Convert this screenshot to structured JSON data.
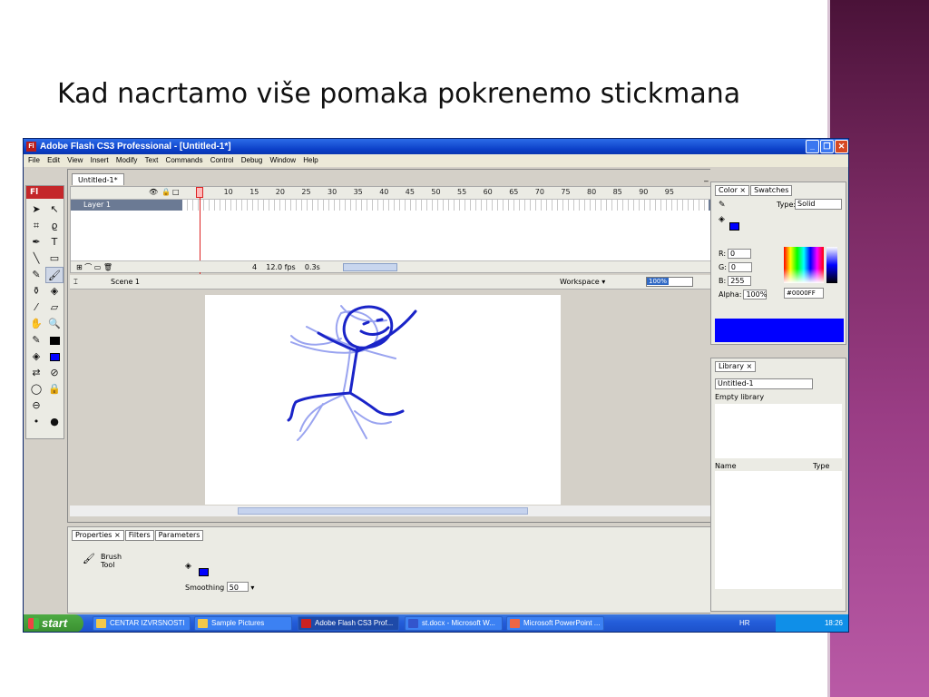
{
  "slide": {
    "title": "Kad nacrtamo više pomaka pokrenemo stickmana"
  },
  "window": {
    "title": "Adobe Flash CS3 Professional - [Untitled-1*]",
    "logo": "Fl",
    "controls": [
      "minimize-icon",
      "restore-icon",
      "close-icon"
    ]
  },
  "menu": [
    "File",
    "Edit",
    "View",
    "Insert",
    "Modify",
    "Text",
    "Commands",
    "Control",
    "Debug",
    "Window",
    "Help"
  ],
  "tools": {
    "header": "Fl",
    "items": [
      "selection-icon",
      "subselection-icon",
      "free-transform-icon",
      "lasso-icon",
      "pen-icon",
      "text-icon",
      "line-icon",
      "rectangle-icon",
      "pencil-icon",
      "brush-icon",
      "ink-bottle-icon",
      "paint-bucket-icon",
      "eyedropper-icon",
      "eraser-icon",
      "hand-icon",
      "zoom-icon"
    ],
    "stroke_color": "#000000",
    "fill_color": "#0000FF"
  },
  "document": {
    "tab": "Untitled-1*",
    "timeline": {
      "frame_numbers": [
        "5",
        "10",
        "15",
        "20",
        "25",
        "30",
        "35",
        "40",
        "45",
        "50",
        "55",
        "60",
        "65",
        "70",
        "75",
        "80",
        "85",
        "90",
        "95"
      ],
      "layer_name": "Layer 1",
      "current_frame": "4",
      "fps": "12.0 fps",
      "time": "0.3s"
    },
    "scene": "Scene 1",
    "workspace": "Workspace ▾",
    "zoom": "100%"
  },
  "properties": {
    "tabs": [
      "Properties ×",
      "Filters",
      "Parameters"
    ],
    "tool_name_line1": "Brush",
    "tool_name_line2": "Tool",
    "smoothing_label": "Smoothing",
    "smoothing_value": "50",
    "fill_color": "#0000FF"
  },
  "color_panel": {
    "tabs": [
      "Color ×",
      "Swatches"
    ],
    "type_label": "Type:",
    "type_value": "Solid",
    "r_label": "R:",
    "r_value": "0",
    "g_label": "G:",
    "g_value": "0",
    "b_label": "B:",
    "b_value": "255",
    "alpha_label": "Alpha:",
    "alpha_value": "100%",
    "hex_value": "#0000FF",
    "color": "#0000FF"
  },
  "library": {
    "tab": "Library ×",
    "document": "Untitled-1",
    "empty_text": "Empty library",
    "col_name": "Name",
    "col_type": "Type"
  },
  "taskbar": {
    "start": "start",
    "tasks": [
      "CENTAR IZVRSNOSTI",
      "Sample Pictures",
      "Adobe Flash CS3 Prof...",
      "st.docx - Microsoft W...",
      "Microsoft PowerPoint ..."
    ],
    "active_task": "Adobe Flash CS3 Prof...",
    "lang": "HR",
    "clock": "18:26"
  }
}
